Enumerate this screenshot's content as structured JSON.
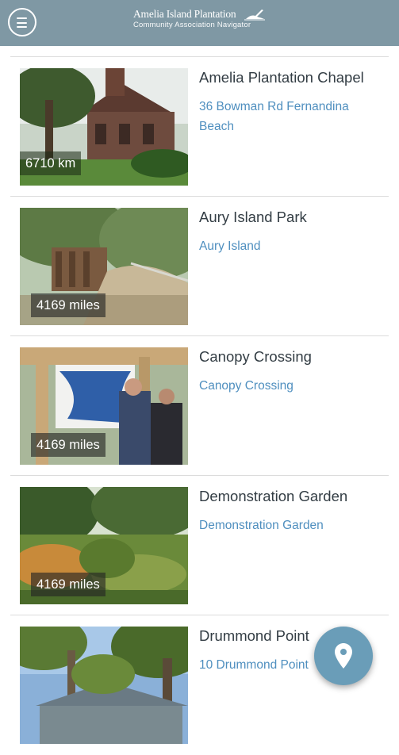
{
  "header": {
    "menu_icon": "hamburger-menu-icon",
    "brand_title": "Amelia Island Plantation",
    "brand_subtitle": "Community Association Navigator",
    "colors": {
      "bar": "#7f98a4",
      "text": "#ffffff"
    }
  },
  "places": [
    {
      "title": "Amelia Plantation Chapel",
      "address": "36 Bowman Rd Fernandina Beach",
      "distance": "6710 km"
    },
    {
      "title": "Aury Island Park",
      "address": "Aury Island",
      "distance": "4169 miles"
    },
    {
      "title": "Canopy Crossing",
      "address": "Canopy Crossing",
      "distance": "4169 miles"
    },
    {
      "title": "Demonstration Garden",
      "address": "Demonstration Garden",
      "distance": "4169 miles"
    },
    {
      "title": "Drummond Point",
      "address": "10 Drummond Point",
      "distance": ""
    }
  ],
  "fab": {
    "icon": "map-pin-icon",
    "color": "#6a9db8"
  },
  "colors": {
    "title": "#333d44",
    "address": "#4f8fbf",
    "divider": "#dcdcdc"
  }
}
